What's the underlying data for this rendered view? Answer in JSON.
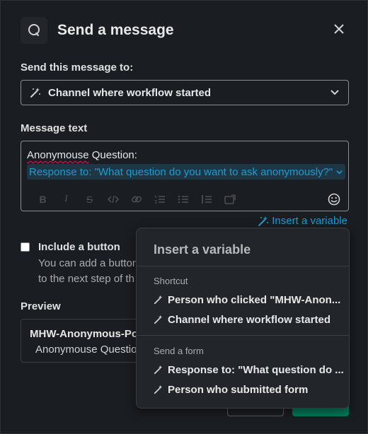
{
  "header": {
    "title": "Send a message",
    "icon": "search-icon",
    "close_icon": "close-icon"
  },
  "recipient": {
    "label": "Send this message to:",
    "selected": "Channel where workflow started",
    "icon": "magic-wand-icon"
  },
  "message": {
    "label": "Message text",
    "line1_word": "Anonymouse",
    "line1_rest": " Question:",
    "variable_pill": "Response to: \"What question do you want to ask anonymously?\"",
    "toolbar": [
      "B",
      "I",
      "S"
    ],
    "insert_variable_link": "Insert a variable"
  },
  "include_button": {
    "label": "Include a button",
    "description_line1": "You can add a button",
    "description_line2": "to the next step of th",
    "checked": false
  },
  "preview": {
    "label": "Preview",
    "title": "MHW-Anonymous-Po",
    "body": "Anonymouse Questio"
  },
  "popover": {
    "title": "Insert a variable",
    "sections": [
      {
        "name": "Shortcut",
        "items": [
          "Person who clicked \"MHW-Anon...",
          "Channel where workflow started"
        ]
      },
      {
        "name": "Send a form",
        "items": [
          "Response to: \"What question do ...",
          "Person who submitted form"
        ]
      }
    ]
  },
  "colors": {
    "background": "#1a1d21",
    "link": "#1d9bd1",
    "primary_button": "#007a5a",
    "popover": "#222529"
  }
}
